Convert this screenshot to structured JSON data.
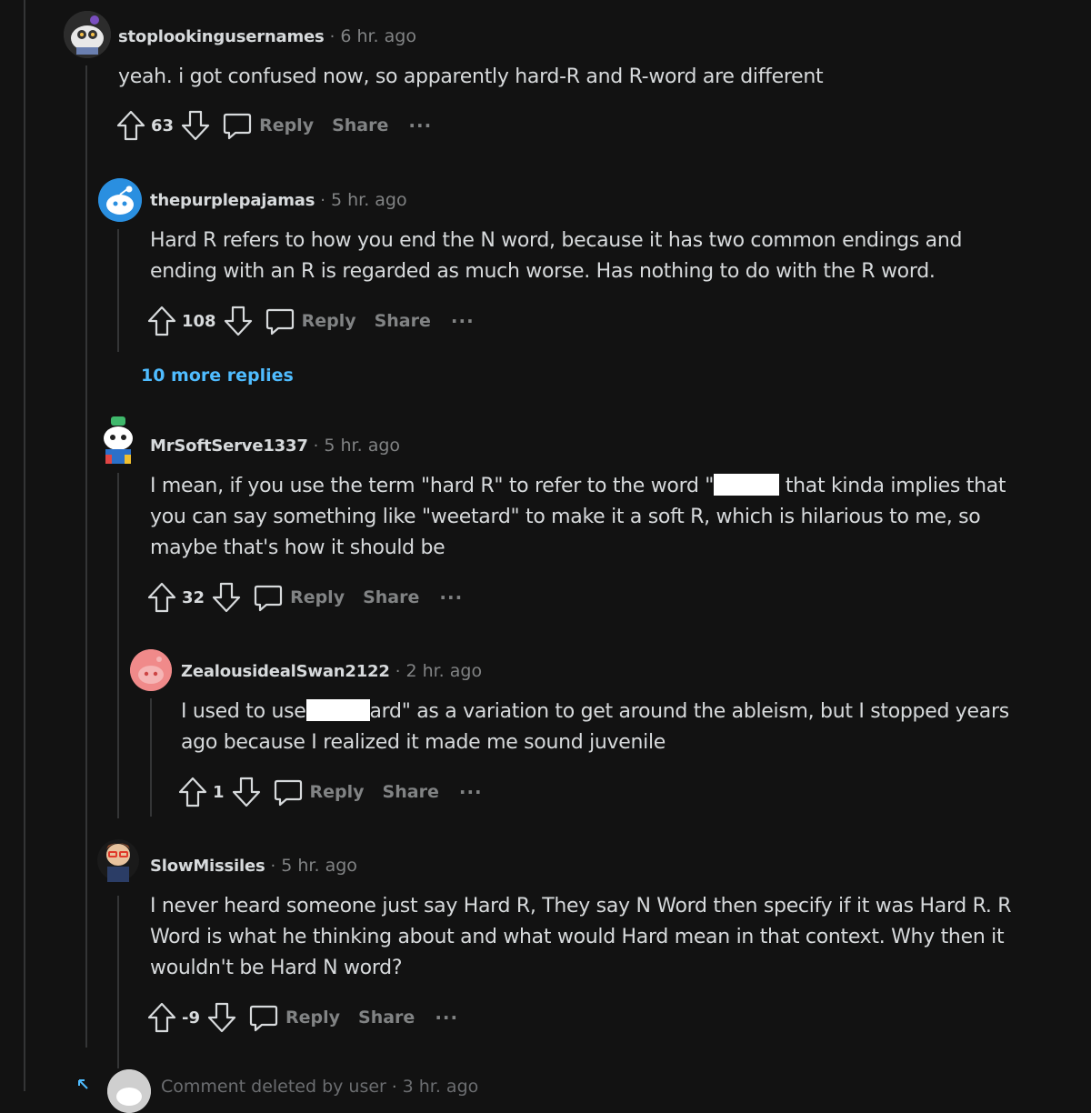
{
  "colors": {
    "background": "#121212",
    "text": "#d7dadc",
    "muted": "#818384",
    "link": "#4fbcff",
    "thread_line": "#343536"
  },
  "comments": [
    {
      "username": "stoplookingusernames",
      "time": "6 hr. ago",
      "body": "yeah. i got confused now, so apparently hard-R and R-word are different",
      "votes": "63",
      "reply_label": "Reply",
      "share_label": "Share",
      "more_label": "···"
    },
    {
      "username": "thepurplepajamas",
      "time": "5 hr. ago",
      "body": "Hard R refers to how you end the N word, because it has two common endings and ending with an R is regarded as much worse. Has nothing to do with the R word.",
      "votes": "108",
      "reply_label": "Reply",
      "share_label": "Share",
      "more_label": "···",
      "more_replies": "10 more replies"
    },
    {
      "username": "MrSoftServe1337",
      "time": "5 hr. ago",
      "body_before": "I mean, if you use the term \"hard R\" to refer to the word \"",
      "body_after": " that kinda implies that you can say something like \"weetard\" to make it a soft R, which is hilarious to me, so maybe that's how it should be",
      "votes": "32",
      "reply_label": "Reply",
      "share_label": "Share",
      "more_label": "···"
    },
    {
      "username": "ZealousidealSwan2122",
      "time": "2 hr. ago",
      "body_before": "I used to use",
      "body_after": "ard\" as a variation to get around the ableism, but I stopped years ago because I realized it made me sound juvenile",
      "votes": "1",
      "reply_label": "Reply",
      "share_label": "Share",
      "more_label": "···"
    },
    {
      "username": "SlowMissiles",
      "time": "5 hr. ago",
      "body": "I never heard someone just say Hard R, They say N Word then specify if it was Hard R. R Word is what he thinking about and what would Hard mean in that context. Why then it wouldn't be Hard N word?",
      "votes": "-9",
      "reply_label": "Reply",
      "share_label": "Share",
      "more_label": "···"
    }
  ],
  "deleted": {
    "text": "Comment deleted by user",
    "time": "3 hr. ago"
  }
}
